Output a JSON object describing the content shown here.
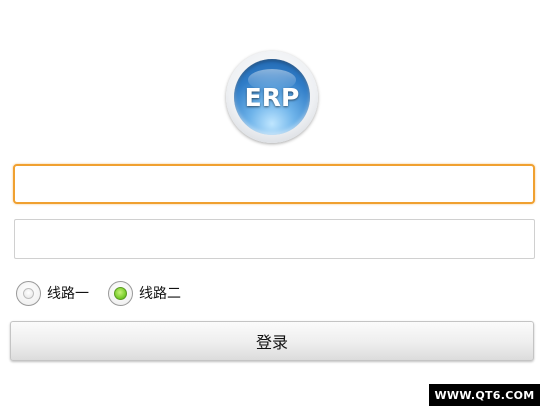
{
  "logo": {
    "text": "ERP",
    "icon": "erp-logo-icon"
  },
  "form": {
    "username": {
      "value": "",
      "placeholder": ""
    },
    "password": {
      "value": "",
      "placeholder": ""
    },
    "route_options": [
      {
        "label": "线路一",
        "selected": false
      },
      {
        "label": "线路二",
        "selected": true
      }
    ],
    "login_label": "登录"
  },
  "colors": {
    "focus_border": "#f0a030",
    "radio_selected": "#7ccf2e"
  },
  "watermark": {
    "text": "WWW.QT6.COM"
  }
}
